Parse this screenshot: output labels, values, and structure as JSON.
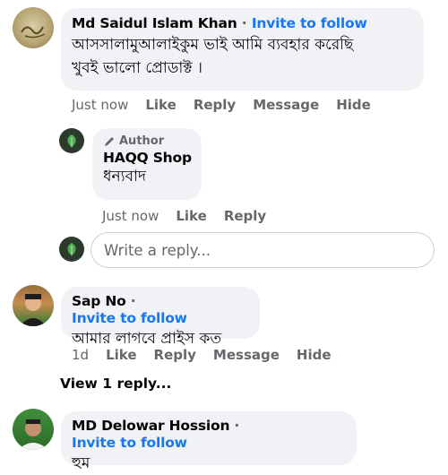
{
  "comments": [
    {
      "author": "Md Saidul Islam Khan",
      "invite": "Invite to follow",
      "text_line1": "আসসালামুআলাইকুম ভাই আমি ব্যবহার করেছি",
      "text_line2": "খুবই ভালো প্রোডাক্ট ।",
      "actions": {
        "time": "Just now",
        "like": "Like",
        "reply": "Reply",
        "message": "Message",
        "hide": "Hide"
      }
    },
    {
      "author": "Sap No",
      "invite": "Invite to follow",
      "text_line1": "আমার লাগবে প্রাইস কত",
      "actions": {
        "time": "1d",
        "like": "Like",
        "reply": "Reply",
        "message": "Message",
        "hide": "Hide"
      }
    },
    {
      "author": "MD Delowar Hossion",
      "invite": "Invite to follow",
      "text_line1": "হুম"
    }
  ],
  "author_reply": {
    "badge": "Author",
    "author": "HAQQ Shop",
    "text": "ধন্যবাদ",
    "actions": {
      "time": "Just now",
      "like": "Like",
      "reply": "Reply"
    }
  },
  "reply_box": {
    "placeholder": "Write a reply..."
  },
  "view_replies": "View 1 reply...",
  "separator": "·",
  "colors": {
    "link": "#1877f2",
    "bubble": "#f0f2f5",
    "muted": "#65676b"
  }
}
